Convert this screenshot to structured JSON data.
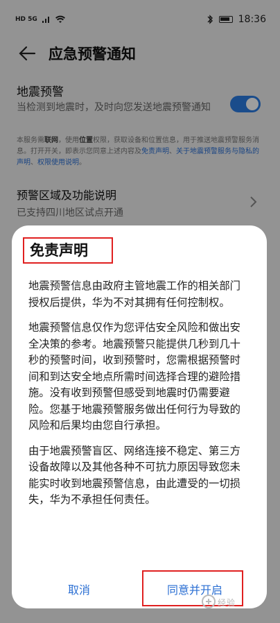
{
  "status_bar": {
    "time": "18:36",
    "left_indicators": "HD  5G"
  },
  "header": {
    "title": "应急预警通知"
  },
  "earthquake": {
    "title": "地震预警",
    "description": "当检测到地震时，及时向您发送地震预警通知",
    "toggle_on": true,
    "notice_part1": "本服务需",
    "notice_bold1": "联网",
    "notice_part2": "，使用",
    "notice_bold2": "位置",
    "notice_part3": "权限，获取设备和位置信息，用于推送地震预警服务消息。打开开关，即表示您同意上述内容及",
    "notice_link1": "免责声明",
    "notice_sep1": "、",
    "notice_link2": "关于地震预警服务与隐私的声明",
    "notice_sep2": "、",
    "notice_link3": "权限使用说明",
    "notice_end": "。"
  },
  "region": {
    "title": "预警区域及功能说明",
    "subtitle": "已支持四川地区试点开通"
  },
  "dialog": {
    "title": "免责声明",
    "paragraphs": [
      "地震预警信息由政府主管地震工作的相关部门授权后提供，华为不对其拥有任何控制权。",
      "地震预警信息仅作为您评估安全风险和做出安全决策的参考。地震预警只能提供几秒到几十秒的预警时间，收到预警时，您需根据预警时间和到达安全地点所需时间选择合理的避险措施。没有收到预警但感受到地震时仍需要避险。您基于地震预警服务做出任何行为导致的风险和后果均由您自行承担。",
      "由于地震预警盲区、网络连接不稳定、第三方设备故障以及其他各种不可抗力原因导致您未能实时收到地震预警信息，由此遭受的一切损失，华为不承担任何责任。"
    ],
    "cancel_label": "取消",
    "agree_label": "同意并开启"
  },
  "watermark": {
    "text": "经验"
  },
  "colors": {
    "accent": "#2b6fd3",
    "highlight": "#e02020",
    "toggle": "#2b7be0"
  }
}
